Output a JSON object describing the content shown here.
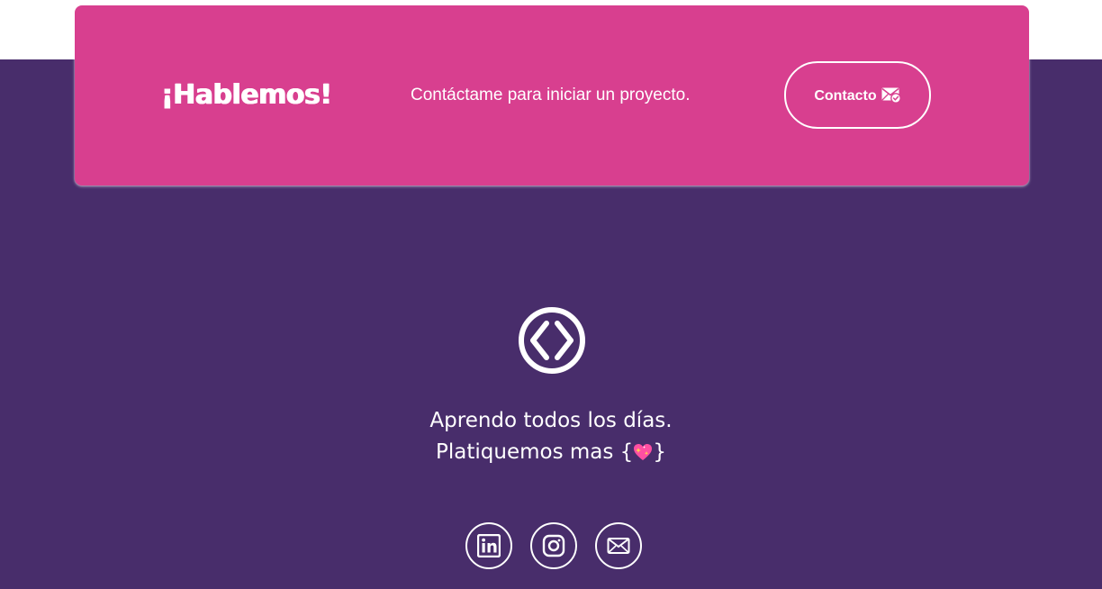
{
  "cta": {
    "title": "¡Hablemos!",
    "text": "Contáctame para iniciar un proyecto.",
    "button_label": "Contacto",
    "button_icon": "mail-check-icon"
  },
  "footer": {
    "logo_icon": "code-brackets-icon",
    "tagline_line1": "Aprendo todos los días.",
    "tagline_line2_prefix": "Platiquemos mas {",
    "tagline_emoji": "sparkling-heart-emoji",
    "tagline_line2_suffix": "}",
    "social_links": [
      {
        "name": "LinkedIn",
        "icon": "linkedin-icon"
      },
      {
        "name": "Instagram",
        "icon": "instagram-icon"
      },
      {
        "name": "Email",
        "icon": "mail-icon"
      }
    ]
  },
  "colors": {
    "cta_background": "#d83f8f",
    "footer_background": "#482d6b",
    "text": "#ffffff",
    "heart_pink": "#ff4fa3",
    "heart_yellow": "#ffd54a"
  }
}
